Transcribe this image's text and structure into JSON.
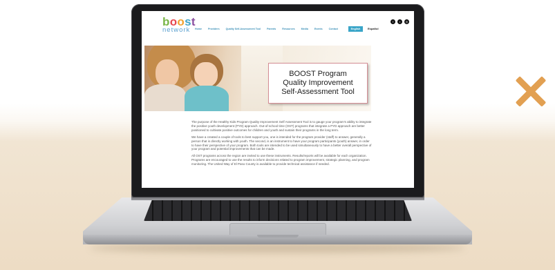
{
  "site": {
    "logo_top": {
      "b": "b",
      "o1": "o",
      "o2": "o",
      "s": "s",
      "t": "t"
    },
    "logo_bottom": "network",
    "nav": [
      "Home",
      "Providers",
      "Quality Self-Assessment Tool",
      "Parents",
      "Resources",
      "Media",
      "Events",
      "Contact"
    ],
    "lang_active": "English",
    "lang_other": "Español",
    "social_icons": [
      "facebook-icon",
      "twitter-icon",
      "instagram-icon"
    ],
    "hero_title_lines": [
      "BOOST Program",
      "Quality Improvement",
      "Self-Assessment Tool"
    ],
    "paragraphs": [
      "The purpose of the Healthy Kids Program Quality Improvement Self Assessment Tool is to gauge your program's ability to integrate the positive youth development (PYD) approach. Out-of-school time (OST) programs that integrate a PYD approach are better positioned to cultivate positive outcomes for children and youth and sustain their programs in the long term.",
      "We have a created a couple of tools to best support you, one is intended for the program provider (staff) to answer, generally a person that is directly working with youth. The second, is an instrument to have your program participants (youth) answer, in order to have their perspective of your program. Both tools are intended to be used simultaneously to have a better overall perspective of your program and potential improvements that can be made.",
      "All OST programs across the region are invited to use these instruments. Results/reports will be available for each organization. Programs are encouraged to use the results to inform decisions related to program improvement, strategic planning, and program monitoring. The United Way of El Paso County is available to provide technical assistance if needed."
    ]
  },
  "colors": {
    "accent_blue": "#3aa5c8",
    "x_mark": "#e2a052",
    "card_border": "#d48c94"
  }
}
